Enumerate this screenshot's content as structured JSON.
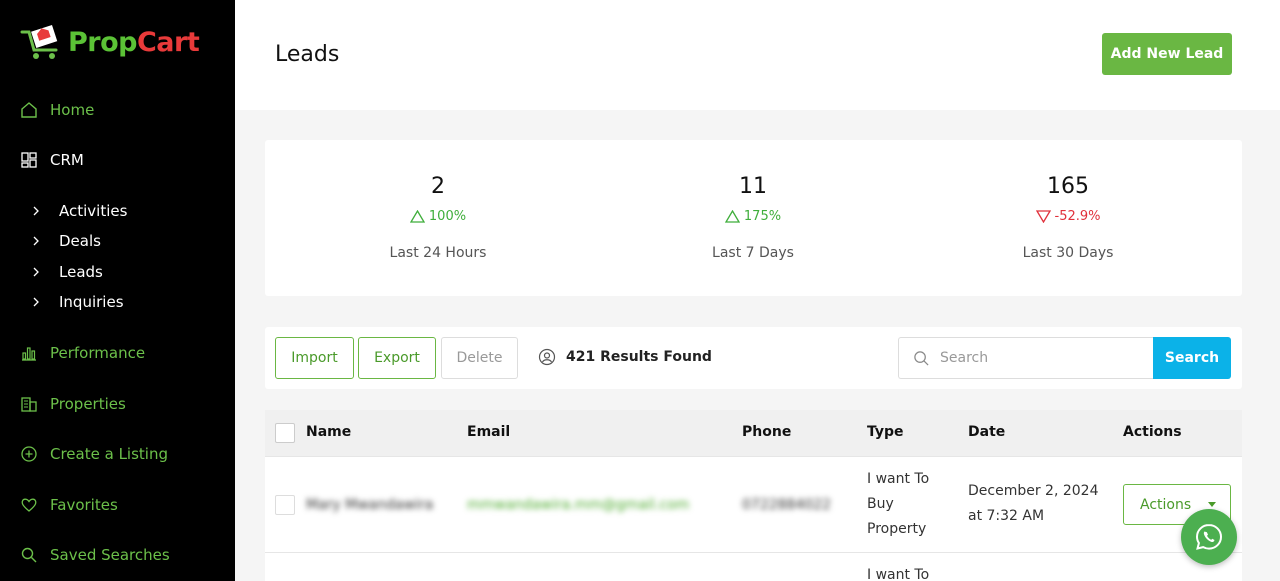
{
  "brand": {
    "name_part1": "Prop",
    "name_part2": "Cart"
  },
  "sidebar": {
    "items": [
      {
        "label": "Home",
        "icon": "home-icon"
      },
      {
        "label": "CRM",
        "icon": "grid-icon"
      },
      {
        "label": "Performance",
        "icon": "bar-chart-icon"
      },
      {
        "label": "Properties",
        "icon": "building-icon"
      },
      {
        "label": "Create a Listing",
        "icon": "plus-circle-icon"
      },
      {
        "label": "Favorites",
        "icon": "heart-icon"
      },
      {
        "label": "Saved Searches",
        "icon": "search-icon"
      }
    ],
    "crm_sub": [
      "Activities",
      "Deals",
      "Leads",
      "Inquiries"
    ]
  },
  "header": {
    "title": "Leads",
    "add_button": "Add New Lead"
  },
  "stats": [
    {
      "value": "2",
      "change": "100%",
      "direction": "up",
      "period": "Last 24 Hours"
    },
    {
      "value": "11",
      "change": "175%",
      "direction": "up",
      "period": "Last 7 Days"
    },
    {
      "value": "165",
      "change": "-52.9%",
      "direction": "down",
      "period": "Last 30 Days"
    }
  ],
  "toolbar": {
    "import": "Import",
    "export": "Export",
    "delete": "Delete",
    "results": "421 Results Found",
    "search_placeholder": "Search",
    "search_button": "Search"
  },
  "table": {
    "headers": [
      "Name",
      "Email",
      "Phone",
      "Type",
      "Date",
      "Actions"
    ],
    "rows": [
      {
        "name": "Mary Mwandawira",
        "email": "mmwandawira.mm@gmail.com",
        "phone": "0722884022",
        "type_l1": "I want To",
        "type_l2": "Buy",
        "type_l3": "Property",
        "date_l1": "December 2, 2024",
        "date_l2": "at 7:32 AM",
        "action": "Actions"
      },
      {
        "type_l1": "I want To"
      }
    ]
  },
  "colors": {
    "accent": "#6ab743",
    "search": "#0bb2e8",
    "up": "#3fae3b",
    "down": "#e0303b"
  }
}
